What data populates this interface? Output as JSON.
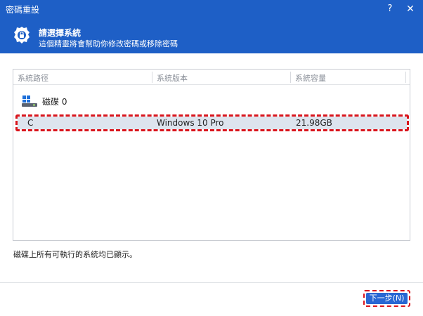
{
  "window": {
    "title": "密碼重設"
  },
  "titlebar": {
    "help_glyph": "?",
    "close_glyph": "✕"
  },
  "header": {
    "icon": "gear-lock-icon",
    "title": "請選擇系統",
    "subtitle": "這個精靈將會幫助你修改密碼或移除密碼"
  },
  "table": {
    "columns": [
      "系統路徑",
      "系統版本",
      "系統容量"
    ],
    "disk": {
      "icon": "windows-disk-icon",
      "label": "磁碟 0"
    },
    "rows": [
      {
        "path": "C",
        "version": "Windows 10 Pro",
        "capacity": "21.98GB"
      }
    ]
  },
  "note": "磁碟上所有可執行的系統均已顯示。",
  "footer": {
    "next_label": "下一步(N)"
  },
  "colors": {
    "brand": "#1e5fc6",
    "button": "#2867d3",
    "selection": "#dde4ee",
    "highlight": "#d9141c"
  }
}
